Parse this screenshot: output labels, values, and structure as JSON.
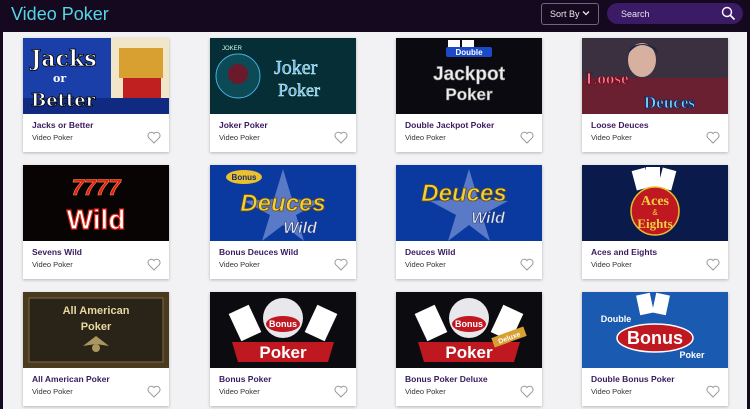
{
  "header": {
    "title": "Video Poker",
    "sort_label": "Sort By",
    "search_placeholder": "Search"
  },
  "colors": {
    "title": "#54d6e6",
    "card_title": "#3a1a5e",
    "search_bg": "#3b1a66",
    "background": "#14091f"
  },
  "games": [
    {
      "title": "Jacks or Better",
      "category": "Video Poker",
      "art_text": [
        "Jacks",
        "or",
        "Better"
      ]
    },
    {
      "title": "Joker Poker",
      "category": "Video Poker",
      "art_text": [
        "Joker",
        "Poker",
        "JOKER"
      ]
    },
    {
      "title": "Double Jackpot Poker",
      "category": "Video Poker",
      "art_text": [
        "Double",
        "Jackpot",
        "Poker"
      ]
    },
    {
      "title": "Loose Deuces",
      "category": "Video Poker",
      "art_text": [
        "Loose",
        "Deuces"
      ]
    },
    {
      "title": "Sevens Wild",
      "category": "Video Poker",
      "art_text": [
        "7777",
        "Wild"
      ]
    },
    {
      "title": "Bonus Deuces Wild",
      "category": "Video Poker",
      "art_text": [
        "Bonus",
        "Deuces",
        "Wild"
      ]
    },
    {
      "title": "Deuces Wild",
      "category": "Video Poker",
      "art_text": [
        "Deuces",
        "Wild"
      ]
    },
    {
      "title": "Aces and Eights",
      "category": "Video Poker",
      "art_text": [
        "Aces",
        "&",
        "Eights"
      ]
    },
    {
      "title": "All American Poker",
      "category": "Video Poker",
      "art_text": [
        "All American",
        "Poker"
      ]
    },
    {
      "title": "Bonus Poker",
      "category": "Video Poker",
      "art_text": [
        "Bonus",
        "Poker"
      ]
    },
    {
      "title": "Bonus Poker Deluxe",
      "category": "Video Poker",
      "art_text": [
        "Bonus",
        "Poker",
        "Deluxe"
      ]
    },
    {
      "title": "Double Bonus Poker",
      "category": "Video Poker",
      "art_text": [
        "Double",
        "Bonus",
        "Poker"
      ]
    }
  ]
}
